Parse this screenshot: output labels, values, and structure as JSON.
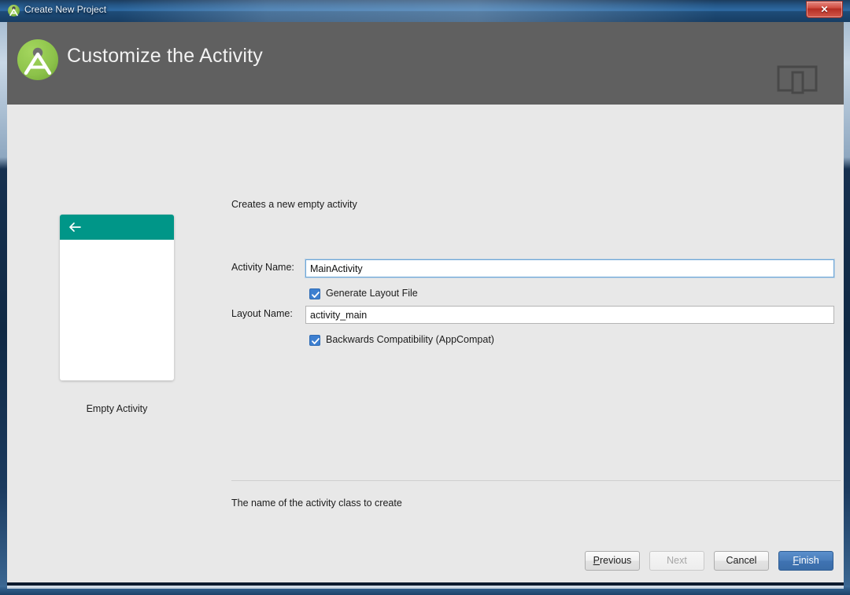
{
  "window": {
    "title": "Create New Project",
    "title_icon": "android-studio-icon",
    "close_label": "✕"
  },
  "header": {
    "title": "Customize the Activity",
    "logo_icon": "android-studio-logo",
    "device_icon": "device-preview-icon"
  },
  "preview": {
    "back_icon": "back-arrow-icon",
    "label": "Empty Activity",
    "toolbar_color": "#009688"
  },
  "form": {
    "description": "Creates a new empty activity",
    "activity_name": {
      "label": "Activity Name:",
      "value": "MainActivity",
      "placeholder": "Activity Name"
    },
    "generate_layout": {
      "label": "Generate Layout File",
      "checked": true
    },
    "layout_name": {
      "label": "Layout Name:",
      "value": "activity_main",
      "placeholder": "Layout Name"
    },
    "backwards_compat": {
      "label": "Backwards Compatibility (AppCompat)",
      "checked": true
    },
    "hint": "The name of the activity class to create"
  },
  "footer": {
    "previous": {
      "label": "Previous",
      "mnemonic": "P"
    },
    "next": {
      "label": "Next",
      "disabled": true
    },
    "cancel": {
      "label": "Cancel"
    },
    "finish": {
      "label": "Finish",
      "mnemonic": "F"
    }
  },
  "colors": {
    "header_grey": "#606060",
    "body_grey": "#e8e8e8",
    "accent_teal": "#009688",
    "accent_blue": "#4a7ebb",
    "logo_green": "#8cc24a"
  }
}
